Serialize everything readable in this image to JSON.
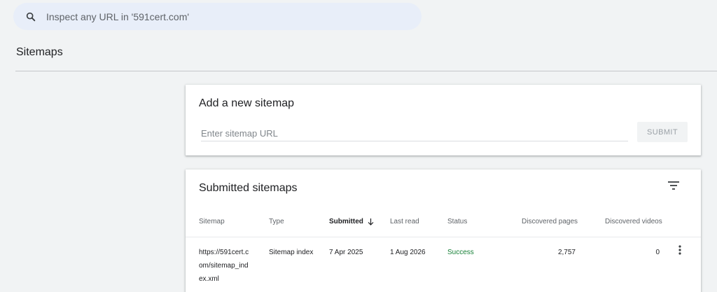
{
  "search": {
    "icon": "search-icon",
    "placeholder": "Inspect any URL in '591cert.com'"
  },
  "page": {
    "title": "Sitemaps"
  },
  "add_sitemap": {
    "title": "Add a new sitemap",
    "input_placeholder": "Enter sitemap URL",
    "input_value": "",
    "submit_label": "SUBMIT"
  },
  "submitted": {
    "title": "Submitted sitemaps",
    "filter_icon": "filter-icon",
    "columns": {
      "sitemap": "Sitemap",
      "type": "Type",
      "submitted": "Submitted",
      "last_read": "Last read",
      "status": "Status",
      "discovered_pages": "Discovered pages",
      "discovered_videos": "Discovered videos"
    },
    "sort_icon": "arrow-down-icon",
    "rows": [
      {
        "sitemap_lines": [
          "https://591cert.c",
          "om/sitemap_ind",
          "ex.xml"
        ],
        "type": "Sitemap index",
        "submitted": "7 Apr 2025",
        "last_read": "1 Aug 2026",
        "status": "Success",
        "discovered_pages": "2,757",
        "discovered_videos": "0",
        "menu_icon": "more-vert-icon"
      }
    ]
  },
  "colors": {
    "background": "#f1f3f4",
    "search_bg": "#e8eef9",
    "success": "#188038",
    "muted_text": "#5f6368"
  }
}
